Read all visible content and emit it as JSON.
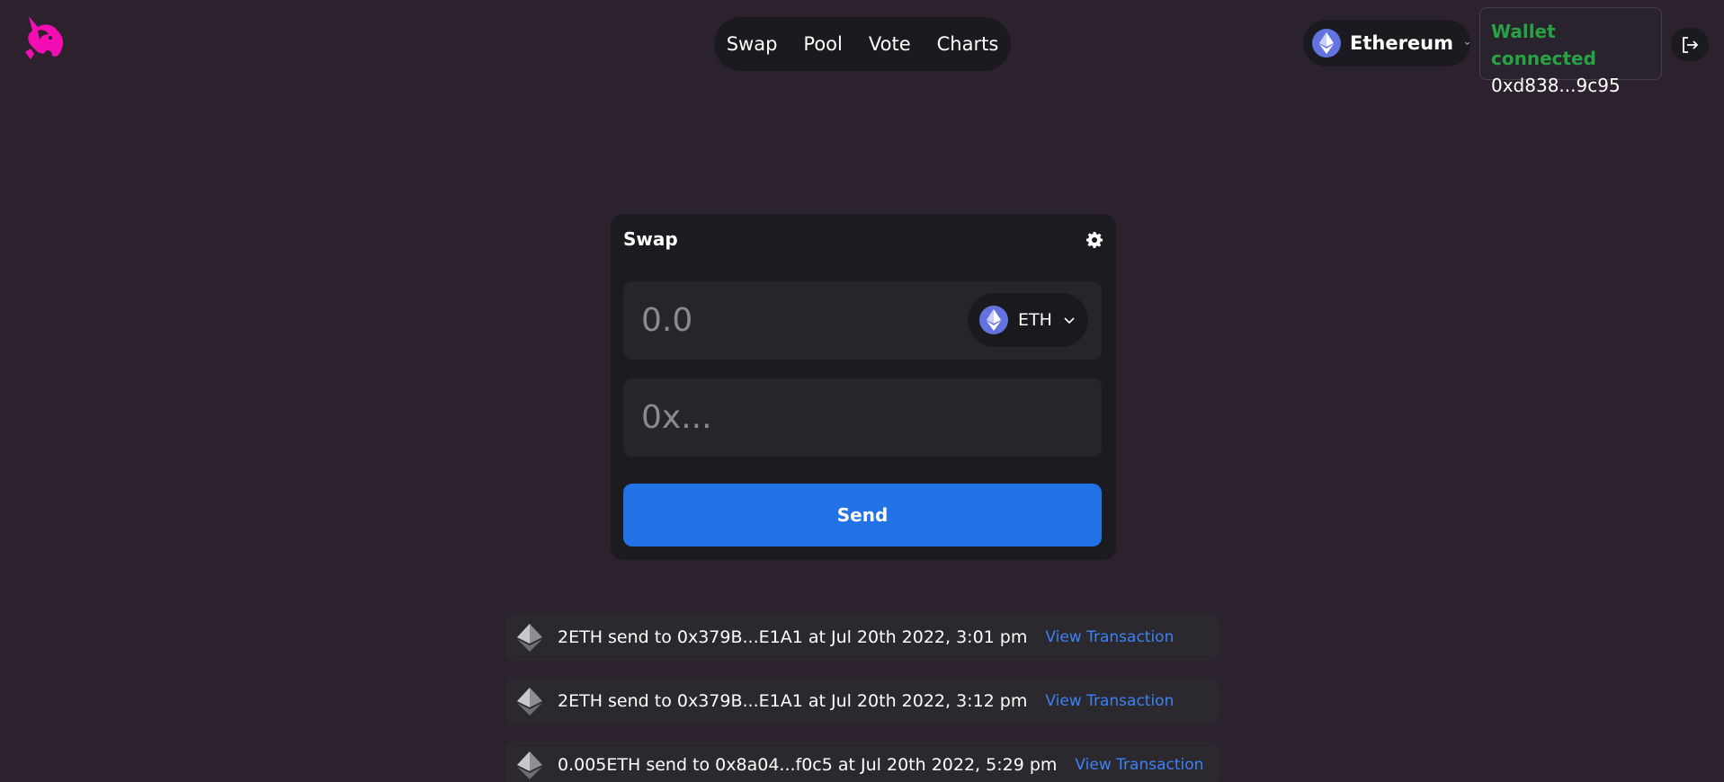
{
  "nav": {
    "items": [
      "Swap",
      "Pool",
      "Vote",
      "Charts"
    ]
  },
  "network": {
    "name": "Ethereum"
  },
  "wallet": {
    "status": "Wallet connected",
    "address": "0xd838...9c95"
  },
  "swap": {
    "title": "Swap",
    "amount_placeholder": "0.0",
    "token": "ETH",
    "address_placeholder": "0x...",
    "send_label": "Send"
  },
  "transactions": [
    {
      "text": "2ETH send to 0x379B...E1A1 at Jul 20th 2022, 3:01 pm",
      "link": "View Transaction"
    },
    {
      "text": "2ETH send to 0x379B...E1A1 at Jul 20th 2022, 3:12 pm",
      "link": "View Transaction"
    },
    {
      "text": "0.005ETH send to 0x8a04...f0c5 at Jul 20th 2022, 5:29 pm",
      "link": "View Transaction"
    }
  ],
  "colors": {
    "background": "#2b222e",
    "accent": "#2172e5",
    "connected": "#27a245",
    "link": "#3b82f6",
    "logo": "#f50db4"
  },
  "icons": {
    "logo": "uniswap-unicorn-logo",
    "network": "ethereum-icon",
    "dropdown": "chevron-down-icon",
    "logout": "logout-icon",
    "settings": "gear-icon"
  }
}
